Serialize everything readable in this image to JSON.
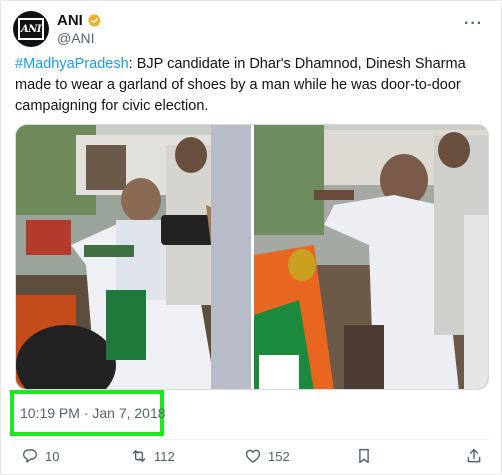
{
  "account": {
    "display_name": "ANI",
    "handle": "@ANI",
    "avatar_text": "ANI"
  },
  "tweet": {
    "hashtag": "#MadhyaPradesh",
    "text": ": BJP candidate in Dhar's Dhamnod, Dinesh Sharma made to wear a garland of shoes by a man while he was door-to-door campaigning for civic election.",
    "timestamp": "10:19 PM · Jan 7, 2018"
  },
  "actions": {
    "replies": "10",
    "reposts": "112",
    "likes": "152"
  },
  "icons": [
    "verified-badge-icon",
    "more-options-icon",
    "reply-icon",
    "repost-icon",
    "like-icon",
    "bookmark-icon",
    "share-icon"
  ],
  "colors": {
    "link": "#1d9bf0",
    "verified": "#e8b02b",
    "highlight_box": "#1ee81e",
    "muted": "#536471"
  }
}
